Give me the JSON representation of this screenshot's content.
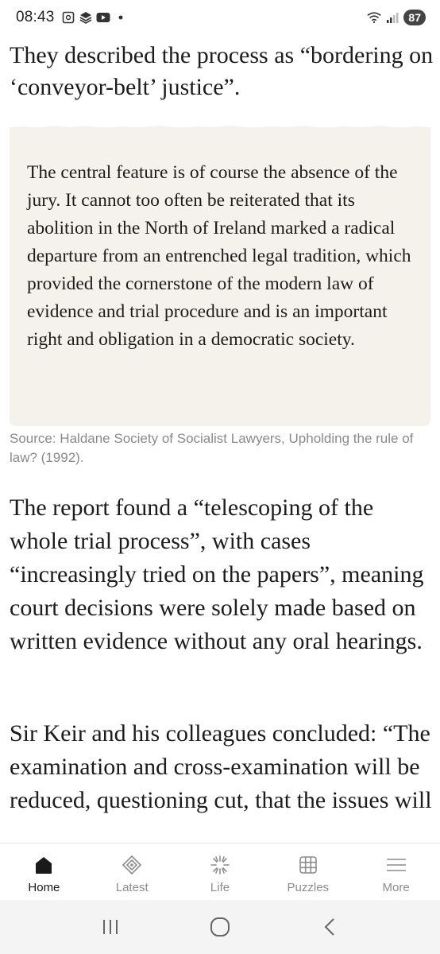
{
  "status_bar": {
    "time": "08:43",
    "battery": "87",
    "icons": [
      "screenshot-icon",
      "app-icon",
      "youtube-icon",
      "dot-icon",
      "wifi-icon",
      "signal-icon"
    ]
  },
  "article": {
    "para1": "They described the process as “bordering on ‘conveyor-belt’ justice”.",
    "quote": "The central feature is of course the absence of the jury. It cannot too often be reiterated that its abolition in the North of Ireland marked a radical departure from an entrenched legal tradition, which provided the cornerstone of the modern law of evidence and trial procedure and is an important right and obligation in a democratic society.",
    "source": "Source: Haldane Society of Socialist Lawyers, Upholding the rule of law? (1992).",
    "para2": "The report found a “telescoping of the whole trial process”, with cases “increasingly tried on the papers”, meaning court decisions were solely made based on written evidence without any oral hearings.",
    "para3": "Sir Keir and his colleagues concluded: “The examination and cross-examination will be reduced, questioning cut, that the issues will"
  },
  "bottom_nav": {
    "items": [
      {
        "label": "Home",
        "icon": "home-icon",
        "active": true
      },
      {
        "label": "Latest",
        "icon": "latest-icon",
        "active": false
      },
      {
        "label": "Life",
        "icon": "life-icon",
        "active": false
      },
      {
        "label": "Puzzles",
        "icon": "puzzles-icon",
        "active": false
      },
      {
        "label": "More",
        "icon": "menu-icon",
        "active": false
      }
    ]
  },
  "system_nav": [
    "recents-button",
    "home-button",
    "back-button"
  ],
  "colors": {
    "quote_background": "#f5f2ec",
    "source_text": "#8a8a8a",
    "nav_inactive": "#8c8c8c",
    "nav_active": "#1a1a1a"
  }
}
